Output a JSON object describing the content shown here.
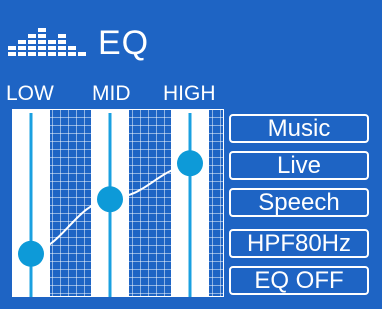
{
  "header": {
    "title": "EQ",
    "icon": "equalizer-bars-icon"
  },
  "bands": [
    {
      "label": "LOW",
      "level": 0.2
    },
    {
      "label": "MID",
      "level": 0.55
    },
    {
      "label": "HIGH",
      "level": 0.78
    }
  ],
  "presets": [
    {
      "label": "Music"
    },
    {
      "label": "Live"
    },
    {
      "label": "Speech"
    },
    {
      "label": "HPF80Hz"
    },
    {
      "label": "EQ OFF"
    }
  ],
  "colors": {
    "background": "#1e64c4",
    "knob": "#0d9ad8",
    "track": "#1aa0e0",
    "foreground": "#ffffff"
  }
}
